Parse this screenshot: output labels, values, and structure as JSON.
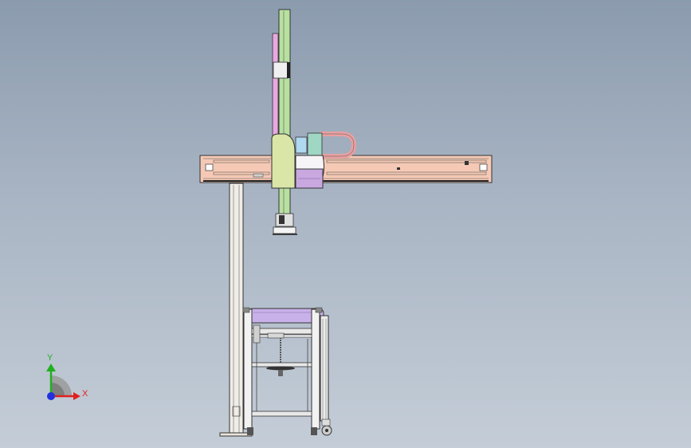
{
  "viewport": {
    "background_top": "#8b9bae",
    "background_bottom": "#c4cdd7"
  },
  "triad": {
    "x_label": "X",
    "y_label": "Y",
    "x_color": "#e02020",
    "y_color": "#20b020",
    "z_color": "#2030e0"
  },
  "model": {
    "beam_color": "#f5c9b5",
    "vertical_axis_color": "#b8e0a0",
    "carriage_color": "#d9e6a8",
    "motor_color": "#9fd6c4",
    "cable_color": "#e8a0a0",
    "roller_color": "#c8b0e8",
    "slide_pink_color": "#e8a8e0"
  }
}
